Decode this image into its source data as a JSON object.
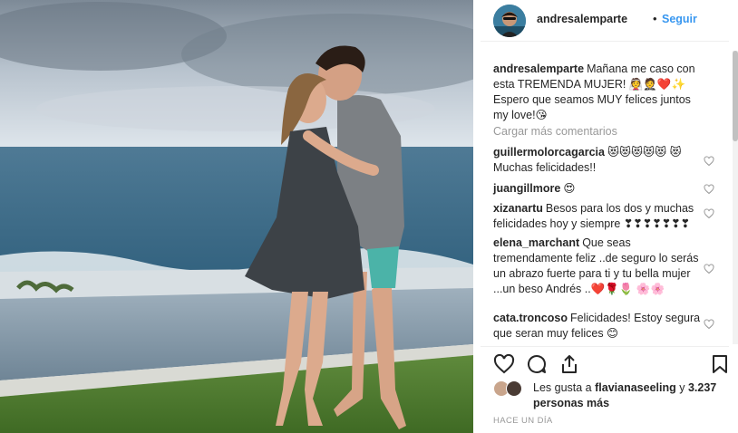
{
  "header": {
    "username": "andresalemparte",
    "separator": "•",
    "follow_label": "Seguir"
  },
  "caption": {
    "username": "andresalemparte",
    "text": "Mañana me caso con esta TREMENDA MUJER! 👰🤵❤️✨ Espero que seamos MUY felices juntos my love!😘"
  },
  "load_more_label": "Cargar más comentarios",
  "comments": [
    {
      "username": "guillermolorcagarcia",
      "text": "😻😻😻😻😻 😻Muchas felicidades!!"
    },
    {
      "username": "juangillmore",
      "text": "😍"
    },
    {
      "username": "xizanartu",
      "text": "Besos para los dos y muchas felicidades hoy y siempre ❣❣❣❣❣❣❣"
    },
    {
      "username": "elena_marchant",
      "text": "Que seas tremendamente feliz ..de seguro lo serás un abrazo fuerte para ti y tu bella mujer ...un beso Andrés ..❤️🌹🌷 🌸🌸"
    },
    {
      "username": "cata.troncoso",
      "text": "Felicidades! Estoy segura que seran muy felices 😊"
    }
  ],
  "likes": {
    "prefix": "Les gusta a",
    "liker": "flavianaseeling",
    "joiner": "y",
    "count_text": "3.237 personas más"
  },
  "timestamp": "HACE UN DÍA",
  "icons": [
    "heart-icon",
    "comment-icon",
    "share-icon",
    "bookmark-icon"
  ],
  "colors": {
    "link": "#3897f0",
    "muted": "#999999",
    "text": "#262626"
  }
}
